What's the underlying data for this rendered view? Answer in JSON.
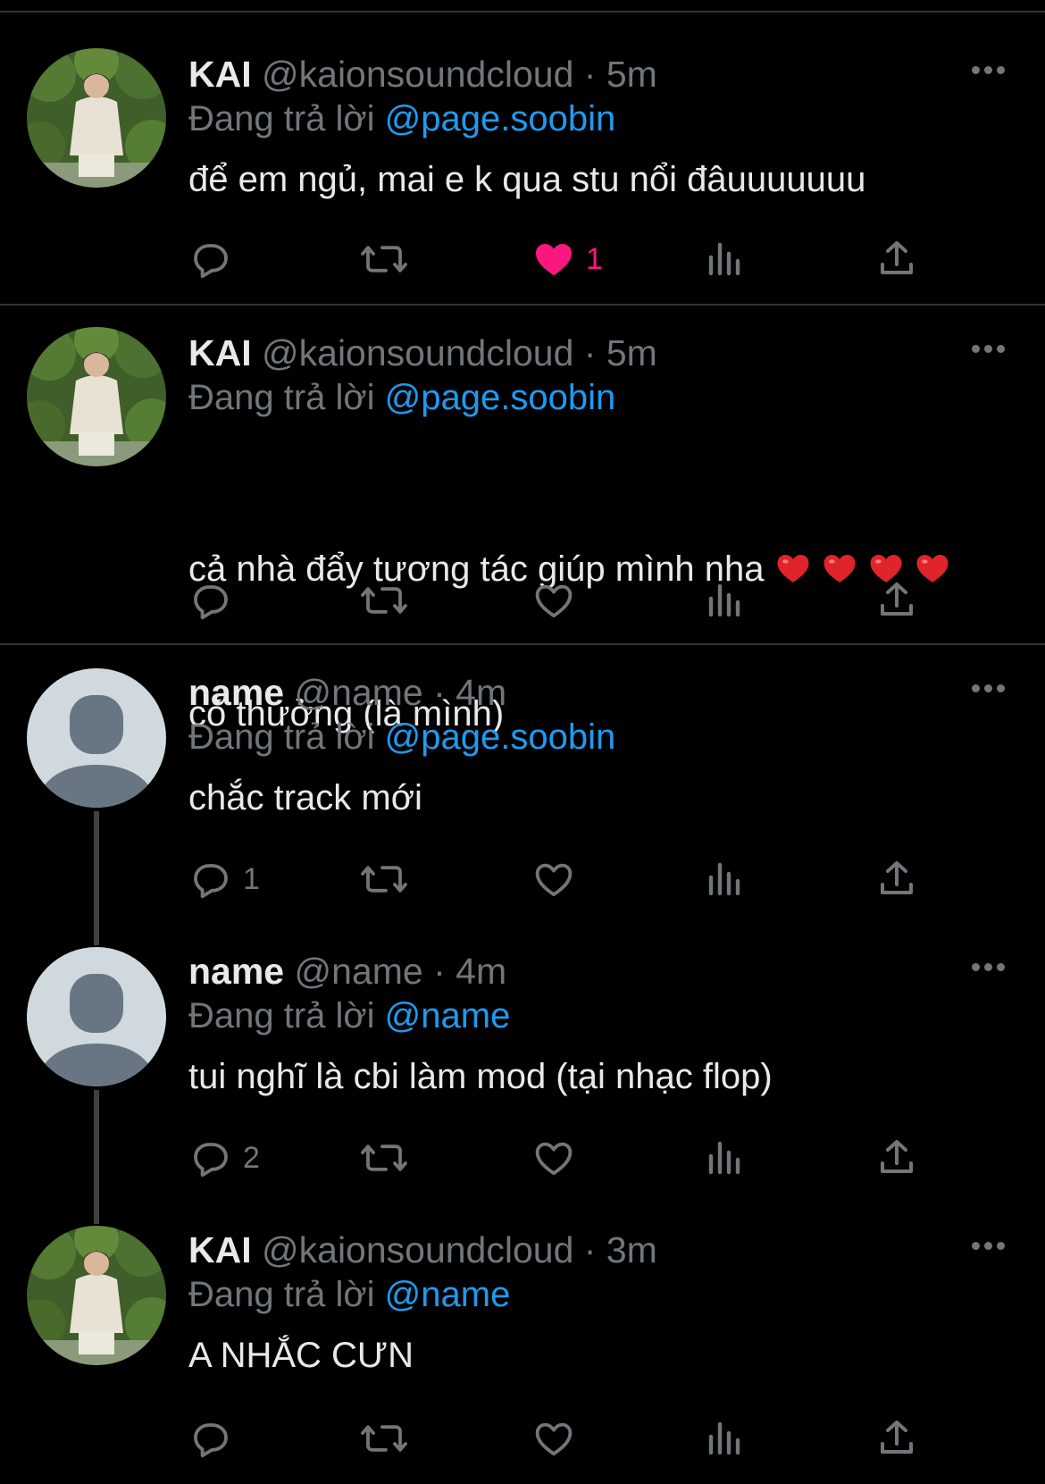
{
  "tweets": [
    {
      "name": "KAI",
      "handle": "@kaionsoundcloud",
      "time": "5m",
      "replying_prefix": "Đang trả lời",
      "replying_to": "@page.soobin",
      "text": "để em ngủ, mai e k qua stu nổi đâuuuuuuu",
      "avatar": "photo",
      "likes": "1",
      "liked": true,
      "replies": ""
    },
    {
      "name": "KAI",
      "handle": "@kaionsoundcloud",
      "time": "5m",
      "replying_prefix": "Đang trả lời",
      "replying_to": "@page.soobin",
      "text_line1": "cả nhà đẩy tương tác giúp mình nha",
      "text_line2": "có thưởng (là mình)",
      "avatar": "photo",
      "likes": "",
      "liked": false,
      "replies": ""
    },
    {
      "name": "name",
      "handle": "@name",
      "time": "4m",
      "replying_prefix": "Đang trả lời",
      "replying_to": "@page.soobin",
      "text": "chắc track mới",
      "avatar": "default",
      "likes": "",
      "liked": false,
      "replies": "1"
    },
    {
      "name": "name",
      "handle": "@name",
      "time": "4m",
      "replying_prefix": "Đang trả lời",
      "replying_to": "@name",
      "text": "tui nghĩ là cbi làm mod (tại nhạc flop)",
      "avatar": "default",
      "likes": "",
      "liked": false,
      "replies": "2"
    },
    {
      "name": "KAI",
      "handle": "@kaionsoundcloud",
      "time": "3m",
      "replying_prefix": "Đang trả lời",
      "replying_to": "@name",
      "text": "A NHẮC CƯN",
      "avatar": "photo",
      "likes": "",
      "liked": false,
      "replies": ""
    }
  ],
  "icons": {
    "reply": "reply-icon",
    "retweet": "retweet-icon",
    "like": "heart-icon",
    "views": "views-icon",
    "share": "share-icon",
    "more": "more-icon"
  },
  "colors": {
    "background": "#000000",
    "text": "#e7e9ea",
    "secondary": "#71767b",
    "link": "#1d9bf0",
    "like_active": "#f91880",
    "divider": "#2f3336"
  }
}
